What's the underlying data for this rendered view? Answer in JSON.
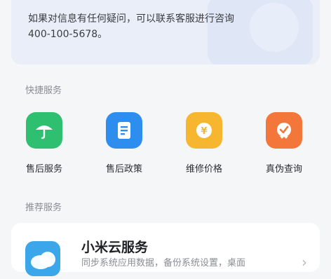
{
  "info": {
    "line1": "如果对信息有任何疑问，可以联系客服进行咨询",
    "line2": "400-100-5678。"
  },
  "quick_services": {
    "title": "快捷服务",
    "items": [
      {
        "label": "售后服务",
        "icon": "umbrella-icon",
        "color": "#2fbf71"
      },
      {
        "label": "售后政策",
        "icon": "document-icon",
        "color": "#2e8ef0"
      },
      {
        "label": "维修价格",
        "icon": "yen-coin-icon",
        "color": "#f6b630"
      },
      {
        "label": "真伪查询",
        "icon": "check-badge-icon",
        "color": "#f3773a"
      }
    ]
  },
  "recommended": {
    "title": "推荐服务",
    "card": {
      "name": "小米云服务",
      "desc": "同步系统应用数据，备份系统设置，桌面",
      "icon": "cloud-icon"
    }
  }
}
